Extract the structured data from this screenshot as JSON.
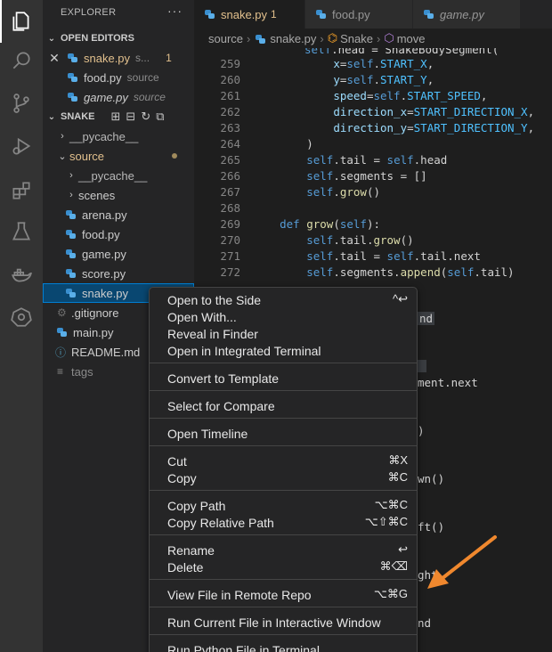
{
  "sidebar": {
    "title": "EXPLORER",
    "more": "···",
    "open_editors": {
      "header": "OPEN EDITORS",
      "items": [
        {
          "name": "snake.py",
          "desc": "s...",
          "badge": "1"
        },
        {
          "name": "food.py",
          "desc": "source"
        },
        {
          "name": "game.py",
          "desc": "source"
        }
      ]
    },
    "project": {
      "header": "SNAKE",
      "items": [
        {
          "name": "__pycache__"
        },
        {
          "name": "source"
        },
        {
          "name": "__pycache__"
        },
        {
          "name": "scenes"
        },
        {
          "name": "arena.py"
        },
        {
          "name": "food.py"
        },
        {
          "name": "game.py"
        },
        {
          "name": "score.py"
        },
        {
          "name": "snake.py"
        },
        {
          "name": ".gitignore"
        },
        {
          "name": "main.py"
        },
        {
          "name": "README.md"
        },
        {
          "name": "tags"
        }
      ]
    }
  },
  "tabs": [
    {
      "label": "snake.py",
      "badge": "1"
    },
    {
      "label": "food.py"
    },
    {
      "label": "game.py"
    }
  ],
  "breadcrumb": [
    "source",
    "snake.py",
    "Snake",
    "move"
  ],
  "editor": {
    "line_numbers": [
      "259",
      "260",
      "261",
      "262",
      "263",
      "264",
      "265",
      "266",
      "267",
      "268",
      "269",
      "270",
      "271",
      "272"
    ],
    "lines": [
      "            x=self.START_X,",
      "            y=self.START_Y,",
      "            speed=self.START_SPEED,",
      "            direction_x=START_DIRECTION_X,",
      "            direction_y=START_DIRECTION_Y,",
      "        )",
      "        self.tail = self.head",
      "        self.segments = []",
      "        self.grow()",
      "",
      "    def grow(self):",
      "        self.tail.grow()",
      "        self.tail = self.tail.next",
      "        self.segments.append(self.tail)"
    ],
    "partial_fragments": {
      "top": "self.head = SnakeBodySegment(",
      "f1": "nd",
      "f2": "ment.next",
      "f3": ")",
      "f4": "wn()",
      "f5": "ft()",
      "f6": "ght",
      "f7": "nd"
    }
  },
  "context_menu": {
    "items": [
      {
        "label": "Open to the Side",
        "key": "^↩"
      },
      {
        "label": "Open With...",
        "key": ""
      },
      {
        "label": "Reveal in Finder",
        "key": ""
      },
      {
        "label": "Open in Integrated Terminal",
        "key": ""
      },
      {
        "label": "Convert to Template",
        "key": ""
      },
      {
        "label": "Select for Compare",
        "key": ""
      },
      {
        "label": "Open Timeline",
        "key": ""
      },
      {
        "label": "Cut",
        "key": "⌘X"
      },
      {
        "label": "Copy",
        "key": "⌘C"
      },
      {
        "label": "Copy Path",
        "key": "⌥⌘C"
      },
      {
        "label": "Copy Relative Path",
        "key": "⌥⇧⌘C"
      },
      {
        "label": "Rename",
        "key": "↩"
      },
      {
        "label": "Delete",
        "key": "⌘⌫"
      },
      {
        "label": "View File in Remote Repo",
        "key": "⌥⌘G"
      },
      {
        "label": "Run Current File in Interactive Window",
        "key": ""
      },
      {
        "label": "Run Python File in Terminal",
        "key": ""
      }
    ]
  },
  "colors": {
    "accent": "#007fd4",
    "modified": "#e2c08d",
    "arrow": "#f0882e"
  }
}
